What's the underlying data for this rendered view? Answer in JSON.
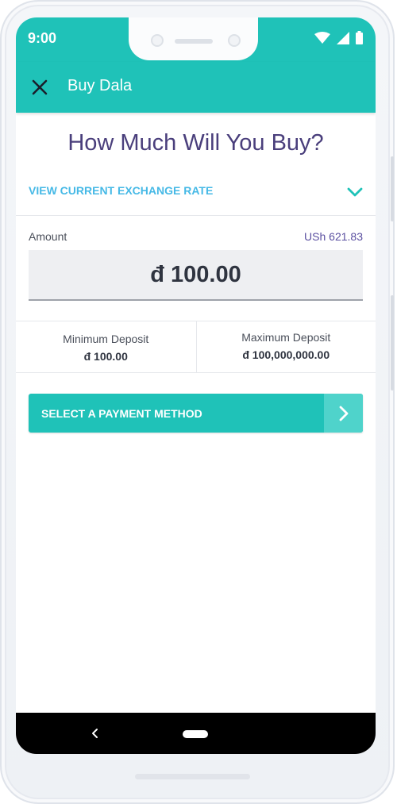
{
  "status_bar": {
    "time": "9:00"
  },
  "app_bar": {
    "title": "Buy Dala"
  },
  "heading": "How Much Will You Buy?",
  "exchange_rate": {
    "label": "VIEW CURRENT EXCHANGE RATE"
  },
  "amount": {
    "label": "Amount",
    "local_value": "USh 621.83",
    "value": "đ 100.00"
  },
  "limits": {
    "minimum": {
      "title": "Minimum Deposit",
      "value": "đ 100.00"
    },
    "maximum": {
      "title": "Maximum Deposit",
      "value": "đ 100,000,000.00"
    }
  },
  "payment_button": {
    "label": "SELECT A PAYMENT METHOD"
  },
  "colors": {
    "accent": "#1fc2b8",
    "heading": "#4a3f7c",
    "link": "#46b9e6"
  },
  "icons": {
    "close": "close-icon",
    "chevron_down": "chevron-down-icon",
    "chevron_right": "chevron-right-icon",
    "wifi": "wifi-icon",
    "signal": "signal-icon",
    "battery": "battery-icon",
    "back": "nav-back-icon"
  }
}
